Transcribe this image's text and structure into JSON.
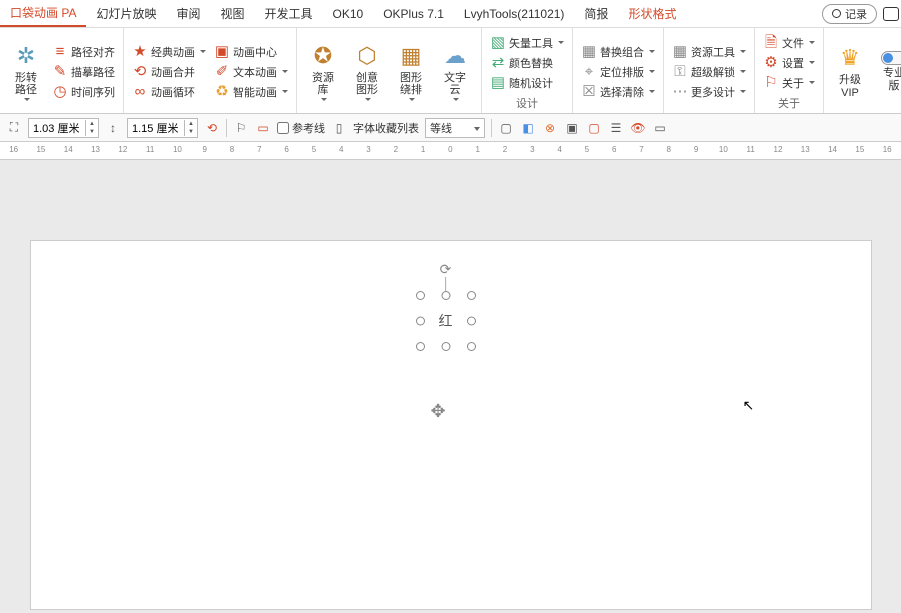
{
  "tabs": {
    "active": "口袋动画 PA",
    "items": [
      "口袋动画 PA",
      "幻灯片放映",
      "审阅",
      "视图",
      "开发工具",
      "OK10",
      "OKPlus 7.1",
      "LvyhTools(211021)",
      "简报",
      "形状格式"
    ],
    "record": "记录"
  },
  "ribbon": {
    "g1": {
      "shape_path": "形转路径",
      "path_align": "路径对齐",
      "trace_path": "描摹路径",
      "time_seq": "时间序列"
    },
    "g2": {
      "classic": "经典动画",
      "merge": "动画合并",
      "loop": "动画循环",
      "center": "动画中心",
      "text_anim": "文本动画",
      "smart": "智能动画"
    },
    "g3": {
      "resource": "资源库",
      "creative": "创意图形",
      "arrange": "图形绕排",
      "wordcloud": "文字云"
    },
    "g4": {
      "vector": "矢量工具",
      "color_replace": "颜色替换",
      "random": "随机设计",
      "label": "设计"
    },
    "g5": {
      "replace_combo": "替换组合",
      "locate": "定位排版",
      "select_clear": "选择清除"
    },
    "g6": {
      "resource_tool": "资源工具",
      "super_unlock": "超级解锁",
      "more_design": "更多设计"
    },
    "g7": {
      "file": "文件",
      "settings": "设置",
      "about": "关于",
      "label": "关于"
    },
    "g8": {
      "upgrade": "升级",
      "vip": "VIP",
      "pro": "专业版"
    }
  },
  "subbar": {
    "w": "1.03 厘米",
    "h": "1.15 厘米",
    "guide": "参考线",
    "font_list": "字体收藏列表",
    "line_style": "等线"
  },
  "ruler": [
    "16",
    "15",
    "14",
    "13",
    "12",
    "11",
    "10",
    "9",
    "8",
    "7",
    "6",
    "5",
    "4",
    "3",
    "2",
    "1",
    "0",
    "1",
    "2",
    "3",
    "4",
    "5",
    "6",
    "7",
    "8",
    "9",
    "10",
    "11",
    "12",
    "13",
    "14",
    "15",
    "16"
  ],
  "canvas": {
    "selected_text": "红"
  }
}
